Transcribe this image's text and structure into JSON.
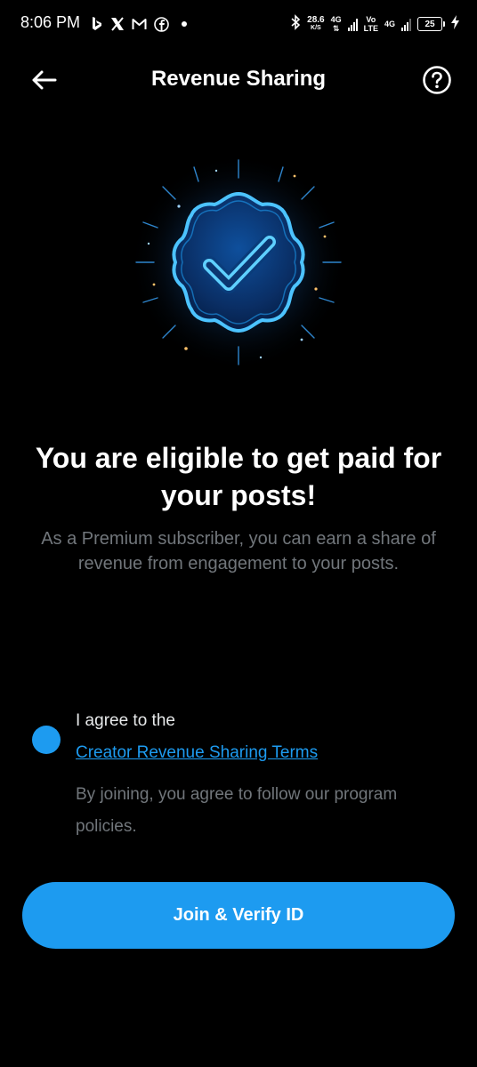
{
  "status_bar": {
    "time": "8:06 PM",
    "net_speed_value": "28.6",
    "net_speed_unit": "K/S",
    "network_1": "4G",
    "network_2_top": "Vo",
    "network_2_bottom": "LTE",
    "network_3": "4G",
    "battery_level": "25",
    "notification_icons": [
      "bing-icon",
      "x-icon",
      "gmail-icon",
      "facebook-icon",
      "dot-icon"
    ]
  },
  "header": {
    "title": "Revenue Sharing",
    "back_icon": "arrow-left-icon",
    "help_icon": "question-circle-icon"
  },
  "hero": {
    "icon": "verified-badge-icon"
  },
  "main": {
    "headline": "You are eligible to get paid for your posts!",
    "subtext": "As a Premium subscriber, you can earn a share of revenue from engagement to your posts."
  },
  "agreement": {
    "label": "I agree to the",
    "terms_link": "Creator Revenue Sharing Terms",
    "policy_note": "By joining, you agree to follow our program policies.",
    "checked": true
  },
  "cta": {
    "label": "Join & Verify ID"
  },
  "colors": {
    "background": "#000000",
    "accent": "#1d9bf0",
    "muted_text": "#71767b",
    "primary_text": "#ffffff"
  }
}
